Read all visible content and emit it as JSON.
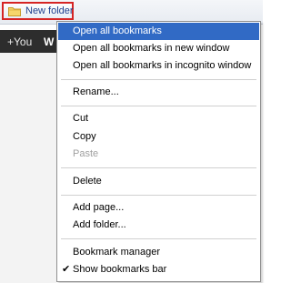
{
  "bookmarks_bar": {
    "folder_label": "New folder",
    "folder_icon": "folder-icon"
  },
  "google_bar": {
    "you_label": "+You",
    "partial_label": "W"
  },
  "context_menu": {
    "items": [
      {
        "label": "Open all bookmarks",
        "state": "highlighted"
      },
      {
        "label": "Open all bookmarks in new window",
        "state": "normal"
      },
      {
        "label": "Open all bookmarks in incognito window",
        "state": "normal"
      },
      {
        "label": "Rename...",
        "state": "normal"
      },
      {
        "label": "Cut",
        "state": "normal"
      },
      {
        "label": "Copy",
        "state": "normal"
      },
      {
        "label": "Paste",
        "state": "disabled"
      },
      {
        "label": "Delete",
        "state": "normal"
      },
      {
        "label": "Add page...",
        "state": "normal"
      },
      {
        "label": "Add folder...",
        "state": "normal"
      },
      {
        "label": "Bookmark manager",
        "state": "normal"
      },
      {
        "label": "Show bookmarks bar",
        "state": "checked"
      }
    ],
    "check_mark": "✔",
    "highlight_color": "#316ac5",
    "disabled_color": "#a0a0a0"
  }
}
